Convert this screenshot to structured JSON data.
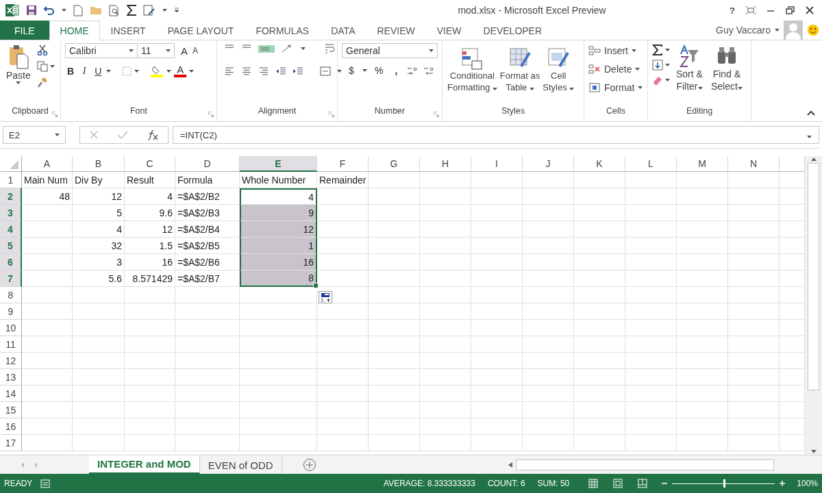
{
  "window": {
    "title": "mod.xlsx - Microsoft Excel Preview",
    "help": "?",
    "user": "Guy Vaccaro"
  },
  "ribbon_tabs": [
    {
      "label": "FILE",
      "kind": "file",
      "selected": false
    },
    {
      "label": "HOME",
      "kind": "tab",
      "selected": true
    },
    {
      "label": "INSERT",
      "kind": "tab",
      "selected": false
    },
    {
      "label": "PAGE LAYOUT",
      "kind": "tab",
      "selected": false
    },
    {
      "label": "FORMULAS",
      "kind": "tab",
      "selected": false
    },
    {
      "label": "DATA",
      "kind": "tab",
      "selected": false
    },
    {
      "label": "REVIEW",
      "kind": "tab",
      "selected": false
    },
    {
      "label": "VIEW",
      "kind": "tab",
      "selected": false
    },
    {
      "label": "DEVELOPER",
      "kind": "tab",
      "selected": false
    }
  ],
  "ribbon": {
    "clipboard": {
      "label": "Clipboard",
      "paste": "Paste"
    },
    "font": {
      "label": "Font",
      "family": "Calibri",
      "size": "11",
      "grow": "A",
      "shrink": "A",
      "styles": [
        "B",
        "I",
        "U"
      ],
      "color_letter": "A"
    },
    "alignment": {
      "label": "Alignment"
    },
    "number": {
      "label": "Number",
      "format": "General",
      "symbols": [
        "$",
        "%",
        ","
      ]
    },
    "styles": {
      "label": "Styles",
      "buttons": [
        {
          "lines": [
            "Conditional",
            "Formatting"
          ]
        },
        {
          "lines": [
            "Format as",
            "Table"
          ]
        },
        {
          "lines": [
            "Cell",
            "Styles"
          ]
        }
      ]
    },
    "cells": {
      "label": "Cells",
      "buttons": [
        "Insert",
        "Delete",
        "Format"
      ]
    },
    "editing": {
      "label": "Editing",
      "buttons": [
        {
          "lines": [
            "Sort &",
            "Filter"
          ]
        },
        {
          "lines": [
            "Find &",
            "Select"
          ]
        }
      ]
    }
  },
  "formula_bar": {
    "name_box": "E2",
    "formula": "=INT(C2)"
  },
  "sheet": {
    "columns": [
      {
        "letter": "A",
        "selected": false
      },
      {
        "letter": "B",
        "selected": false
      },
      {
        "letter": "C",
        "selected": false
      },
      {
        "letter": "D",
        "selected": false
      },
      {
        "letter": "E",
        "selected": true
      },
      {
        "letter": "F",
        "selected": false
      },
      {
        "letter": "G",
        "selected": false
      },
      {
        "letter": "H",
        "selected": false
      },
      {
        "letter": "I",
        "selected": false
      },
      {
        "letter": "J",
        "selected": false
      },
      {
        "letter": "K",
        "selected": false
      },
      {
        "letter": "L",
        "selected": false
      },
      {
        "letter": "M",
        "selected": false
      },
      {
        "letter": "N",
        "selected": false
      }
    ],
    "rows": [
      {
        "number": "1",
        "selected": false,
        "cells": [
          {
            "kind": "text",
            "text": "Main Num",
            "selected": false
          },
          {
            "kind": "text",
            "text": "Div By",
            "selected": false
          },
          {
            "kind": "text",
            "text": "Result",
            "selected": false
          },
          {
            "kind": "text",
            "text": "Formula",
            "selected": false
          },
          {
            "kind": "text",
            "text": "Whole Number",
            "selected": false
          },
          {
            "kind": "text",
            "text": "Remainder",
            "selected": false
          }
        ]
      },
      {
        "number": "2",
        "selected": true,
        "cells": [
          {
            "kind": "number",
            "text": "48",
            "selected": false
          },
          {
            "kind": "number",
            "text": "12",
            "selected": false
          },
          {
            "kind": "number",
            "text": "4",
            "selected": false
          },
          {
            "kind": "text",
            "text": "=$A$2/B2",
            "selected": false
          },
          {
            "kind": "number",
            "text": "4",
            "selected": false
          }
        ]
      },
      {
        "number": "3",
        "selected": true,
        "cells": [
          {
            "kind": "empty",
            "selected": false
          },
          {
            "kind": "number",
            "text": "5",
            "selected": false
          },
          {
            "kind": "number",
            "text": "9.6",
            "selected": false
          },
          {
            "kind": "text",
            "text": "=$A$2/B3",
            "selected": false
          },
          {
            "kind": "number",
            "text": "9",
            "selected": true
          }
        ]
      },
      {
        "number": "4",
        "selected": true,
        "cells": [
          {
            "kind": "empty",
            "selected": false
          },
          {
            "kind": "number",
            "text": "4",
            "selected": false
          },
          {
            "kind": "number",
            "text": "12",
            "selected": false
          },
          {
            "kind": "text",
            "text": "=$A$2/B4",
            "selected": false
          },
          {
            "kind": "number",
            "text": "12",
            "selected": true
          }
        ]
      },
      {
        "number": "5",
        "selected": true,
        "cells": [
          {
            "kind": "empty",
            "selected": false
          },
          {
            "kind": "number",
            "text": "32",
            "selected": false
          },
          {
            "kind": "number",
            "text": "1.5",
            "selected": false
          },
          {
            "kind": "text",
            "text": "=$A$2/B5",
            "selected": false
          },
          {
            "kind": "number",
            "text": "1",
            "selected": true
          }
        ]
      },
      {
        "number": "6",
        "selected": true,
        "cells": [
          {
            "kind": "empty",
            "selected": false
          },
          {
            "kind": "number",
            "text": "3",
            "selected": false
          },
          {
            "kind": "number",
            "text": "16",
            "selected": false
          },
          {
            "kind": "text",
            "text": "=$A$2/B6",
            "selected": false
          },
          {
            "kind": "number",
            "text": "16",
            "selected": true
          }
        ]
      },
      {
        "number": "7",
        "selected": true,
        "cells": [
          {
            "kind": "empty",
            "selected": false
          },
          {
            "kind": "number",
            "text": "5.6",
            "selected": false
          },
          {
            "kind": "number",
            "text": "8.571429",
            "selected": false
          },
          {
            "kind": "text",
            "text": "=$A$2/B7",
            "selected": false
          },
          {
            "kind": "number",
            "text": "8",
            "selected": true
          }
        ]
      },
      {
        "number": "8",
        "selected": false
      },
      {
        "number": "9",
        "selected": false
      },
      {
        "number": "10",
        "selected": false
      },
      {
        "number": "11",
        "selected": false
      },
      {
        "number": "12",
        "selected": false
      },
      {
        "number": "13",
        "selected": false
      },
      {
        "number": "14",
        "selected": false
      },
      {
        "number": "15",
        "selected": false
      },
      {
        "number": "16",
        "selected": false
      },
      {
        "number": "17",
        "selected": false
      }
    ]
  },
  "sheet_tabs": [
    {
      "label": "INTEGER and MOD",
      "selected": true
    },
    {
      "label": "EVEN of ODD",
      "selected": false
    }
  ],
  "status_bar": {
    "mode": "READY",
    "stats": [
      "AVERAGE: 8.333333333",
      "COUNT: 6",
      "SUM: 50"
    ],
    "zoom": {
      "text": "100%",
      "level": 0.5
    }
  }
}
